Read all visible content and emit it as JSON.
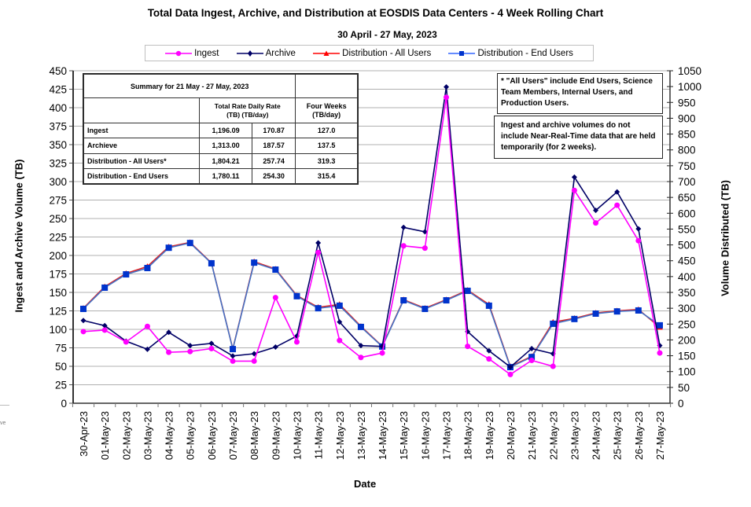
{
  "chart_data": {
    "type": "line",
    "title": "Total Data Ingest, Archive, and Distribution at EOSDIS Data Centers - 4 Week Rolling Chart",
    "subtitle": "30 April    - 27 May, 2023",
    "xlabel": "Date",
    "ylabel_left": "Ingest and Archive Volume (TB)",
    "ylabel_right": "Volume Distributed (TB)",
    "ylim_left": [
      0,
      450
    ],
    "ylim_right": [
      0,
      1050
    ],
    "yticks_left": [
      0,
      25,
      50,
      75,
      100,
      125,
      150,
      175,
      200,
      225,
      250,
      275,
      300,
      325,
      350,
      375,
      400,
      425,
      450
    ],
    "yticks_right": [
      0,
      50,
      100,
      150,
      200,
      250,
      300,
      350,
      400,
      450,
      500,
      550,
      600,
      650,
      700,
      750,
      800,
      850,
      900,
      950,
      1000,
      1050
    ],
    "grid": true,
    "legend_position": "top",
    "categories": [
      "30-Apr-23",
      "01-May-23",
      "02-May-23",
      "03-May-23",
      "04-May-23",
      "05-May-23",
      "06-May-23",
      "07-May-23",
      "08-May-23",
      "09-May-23",
      "10-May-23",
      "11-May-23",
      "12-May-23",
      "13-May-23",
      "14-May-23",
      "15-May-23",
      "16-May-23",
      "17-May-23",
      "18-May-23",
      "19-May-23",
      "20-May-23",
      "21-May-23",
      "22-May-23",
      "23-May-23",
      "24-May-23",
      "25-May-23",
      "26-May-23",
      "27-May-23"
    ],
    "series": [
      {
        "name": "Ingest",
        "axis": "left",
        "color": "#ff00ff",
        "marker": "circle",
        "values": [
          97,
          99,
          83,
          104,
          69,
          70,
          74,
          57,
          57,
          143,
          83,
          204,
          85,
          62,
          68,
          213,
          210,
          414,
          77,
          60,
          39,
          58,
          50,
          288,
          244,
          268,
          220,
          68
        ]
      },
      {
        "name": "Archive",
        "axis": "left",
        "color": "#000066",
        "marker": "diamond",
        "values": [
          112,
          105,
          84,
          73,
          96,
          78,
          81,
          64,
          67,
          76,
          91,
          217,
          110,
          78,
          77,
          238,
          232,
          428,
          97,
          71,
          49,
          74,
          67,
          306,
          261,
          286,
          236,
          78
        ]
      },
      {
        "name": "Distribution - All Users",
        "axis": "right",
        "color": "#ff0000",
        "marker": "triangle",
        "values": [
          300,
          368,
          410,
          432,
          494,
          508,
          443,
          172,
          447,
          424,
          340,
          303,
          312,
          243,
          180,
          327,
          300,
          327,
          357,
          312,
          116,
          148,
          256,
          268,
          285,
          292,
          296,
          240
        ]
      },
      {
        "name": "Distribution - End Users",
        "axis": "right",
        "color": "#0033cc",
        "marker": "square",
        "values": [
          298,
          365,
          407,
          427,
          491,
          506,
          442,
          171,
          444,
          422,
          338,
          300,
          308,
          241,
          179,
          325,
          298,
          325,
          355,
          308,
          114,
          146,
          251,
          266,
          283,
          290,
          293,
          246
        ]
      }
    ]
  },
  "summary": {
    "title": "Summary for 21 May    - 27 May, 2023",
    "col_total": "Total  Rate Daily Rate",
    "col_total2": "(TB)  (TB/day)",
    "col_four": "Four Weeks",
    "col_four2": "(TB/day)",
    "rows": [
      {
        "label": "Ingest",
        "total": "1,196.09",
        "daily": "170.87",
        "four": "127.0"
      },
      {
        "label": "Archieve",
        "total": "1,313.00",
        "daily": "187.57",
        "four": "137.5"
      },
      {
        "label": "Distribution - All Users*",
        "total": "1,804.21",
        "daily": "257.74",
        "four": "319.3"
      },
      {
        "label": "Distribution - End Users",
        "total": "1,780.11",
        "daily": "254.30",
        "four": "315.4"
      }
    ]
  },
  "notes": {
    "note1": "* \"All Users\" include End Users, Science Team Members, Internal Users, and Production Users.",
    "note2": "Ingest and archive volumes do not include Near-Real-Time data that are held temporarily (for 2 weeks)."
  },
  "fragment_text": "ve"
}
